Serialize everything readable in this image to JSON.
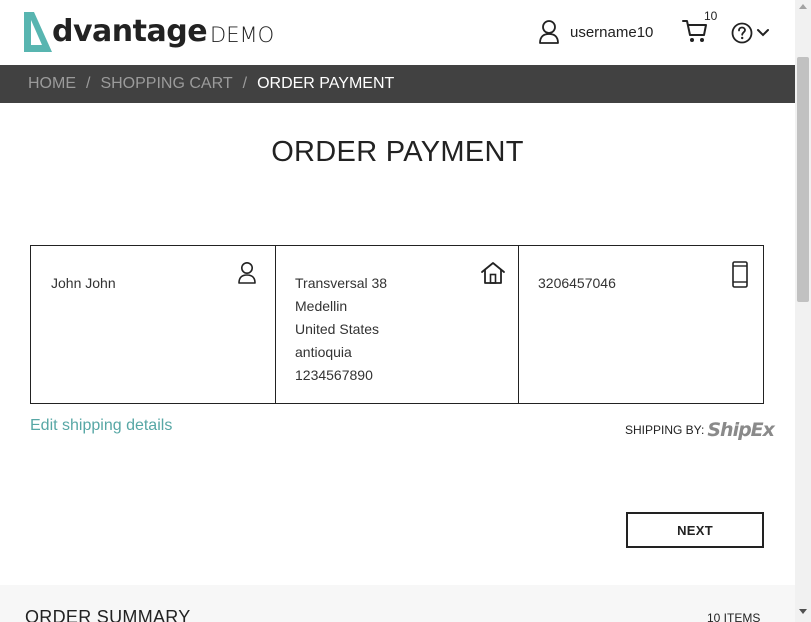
{
  "header": {
    "logo_text": "dvantage",
    "logo_demo": "DEMO",
    "username": "username10",
    "cart_count": "10",
    "icons": [
      "user-icon",
      "cart-icon",
      "help-icon",
      "chevron-down-icon"
    ]
  },
  "breadcrumb": {
    "items": [
      "HOME",
      "SHOPPING CART",
      "ORDER PAYMENT"
    ],
    "separator": "/"
  },
  "page": {
    "title": "ORDER PAYMENT"
  },
  "shipping": {
    "name": "John John",
    "address_lines": [
      "Transversal 38",
      "Medellin",
      "United States",
      "antioquia",
      "1234567890"
    ],
    "phone": "3206457046",
    "edit_label": "Edit shipping details",
    "shipping_by_label": "SHIPPING BY:",
    "carrier": "ShipEx",
    "icons": [
      "person-icon",
      "home-icon",
      "phone-icon"
    ]
  },
  "actions": {
    "next_label": "NEXT"
  },
  "summary": {
    "title": "ORDER SUMMARY",
    "items": "10 ITEMS"
  },
  "colors": {
    "accent": "#57a7a5",
    "breadcrumb_bg": "#414141",
    "logo_teal": "#58b5b0"
  }
}
